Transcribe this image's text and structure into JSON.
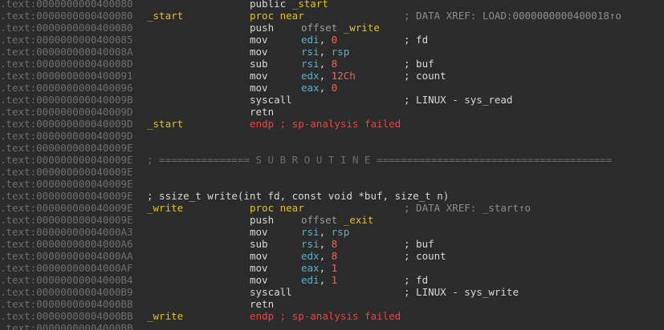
{
  "disassembly": {
    "lines": [
      {
        "addr": ".text:0000000000400080",
        "mnem": [
          {
            "t": "public ",
            "c": "c-text"
          },
          {
            "t": "_start",
            "c": "c-sym"
          }
        ]
      },
      {
        "addr": ".text:0000000000400080",
        "label": "_start",
        "mnem": [
          {
            "t": "proc near",
            "c": "c-sym"
          }
        ],
        "cmt": [
          {
            "t": "; DATA XREF: LOAD:0000000000400018↑o",
            "c": "c-xref"
          }
        ]
      },
      {
        "addr": ".text:0000000000400080",
        "mnem": [
          {
            "t": "push",
            "c": "c-text"
          }
        ],
        "ops": [
          {
            "t": "offset ",
            "c": "c-gray"
          },
          {
            "t": "_write",
            "c": "c-sym"
          }
        ]
      },
      {
        "addr": ".text:0000000000400085",
        "mnem": [
          {
            "t": "mov",
            "c": "c-text"
          }
        ],
        "ops": [
          {
            "t": "edi",
            "c": "c-reg"
          },
          {
            "t": ", ",
            "c": "c-text"
          },
          {
            "t": "0",
            "c": "c-num"
          }
        ],
        "cmt": [
          {
            "t": "; fd",
            "c": "c-text"
          }
        ]
      },
      {
        "addr": ".text:000000000040008A",
        "mnem": [
          {
            "t": "mov",
            "c": "c-text"
          }
        ],
        "ops": [
          {
            "t": "rsi",
            "c": "c-reg"
          },
          {
            "t": ", ",
            "c": "c-text"
          },
          {
            "t": "rsp",
            "c": "c-reg"
          }
        ]
      },
      {
        "addr": ".text:000000000040008D",
        "mnem": [
          {
            "t": "sub",
            "c": "c-text"
          }
        ],
        "ops": [
          {
            "t": "rsi",
            "c": "c-reg"
          },
          {
            "t": ", ",
            "c": "c-text"
          },
          {
            "t": "8",
            "c": "c-num"
          }
        ],
        "cmt": [
          {
            "t": "; buf",
            "c": "c-text"
          }
        ]
      },
      {
        "addr": ".text:0000000000400091",
        "mnem": [
          {
            "t": "mov",
            "c": "c-text"
          }
        ],
        "ops": [
          {
            "t": "edx",
            "c": "c-reg"
          },
          {
            "t": ", ",
            "c": "c-text"
          },
          {
            "t": "12Ch",
            "c": "c-num"
          }
        ],
        "cmt": [
          {
            "t": "; count",
            "c": "c-text"
          }
        ]
      },
      {
        "addr": ".text:0000000000400096",
        "mnem": [
          {
            "t": "mov",
            "c": "c-text"
          }
        ],
        "ops": [
          {
            "t": "eax",
            "c": "c-reg"
          },
          {
            "t": ", ",
            "c": "c-text"
          },
          {
            "t": "0",
            "c": "c-num"
          }
        ]
      },
      {
        "addr": ".text:000000000040009B",
        "mnem": [
          {
            "t": "syscall",
            "c": "c-text"
          }
        ],
        "cmt": [
          {
            "t": "; LINUX - sys_read",
            "c": "c-text"
          }
        ]
      },
      {
        "addr": ".text:000000000040009D",
        "mnem": [
          {
            "t": "retn",
            "c": "c-text"
          }
        ]
      },
      {
        "addr": ".text:000000000040009D",
        "label": "_start",
        "mnem": [
          {
            "t": "endp ; sp-analysis failed",
            "c": "c-red"
          }
        ]
      },
      {
        "addr": ".text:000000000040009D"
      },
      {
        "addr": ".text:000000000040009E"
      },
      {
        "addr": ".text:000000000040009E",
        "full": [
          {
            "t": "; =============== S U B R O U T I N E =======================================",
            "c": "c-dim"
          }
        ]
      },
      {
        "addr": ".text:000000000040009E"
      },
      {
        "addr": ".text:000000000040009E"
      },
      {
        "addr": ".text:000000000040009E",
        "full": [
          {
            "t": "; ssize_t write(int fd, const void *buf, size_t n)",
            "c": "c-text"
          }
        ]
      },
      {
        "addr": ".text:000000000040009E",
        "label": "_write",
        "mnem": [
          {
            "t": "proc near",
            "c": "c-sym"
          }
        ],
        "cmt": [
          {
            "t": "; DATA XREF: _start↑o",
            "c": "c-xref"
          }
        ]
      },
      {
        "addr": ".text:000000000040009E",
        "mnem": [
          {
            "t": "push",
            "c": "c-text"
          }
        ],
        "ops": [
          {
            "t": "offset ",
            "c": "c-gray"
          },
          {
            "t": "_exit",
            "c": "c-sym"
          }
        ]
      },
      {
        "addr": ".text:00000000004000A3",
        "mnem": [
          {
            "t": "mov",
            "c": "c-text"
          }
        ],
        "ops": [
          {
            "t": "rsi",
            "c": "c-reg"
          },
          {
            "t": ", ",
            "c": "c-text"
          },
          {
            "t": "rsp",
            "c": "c-reg"
          }
        ]
      },
      {
        "addr": ".text:00000000004000A6",
        "mnem": [
          {
            "t": "sub",
            "c": "c-text"
          }
        ],
        "ops": [
          {
            "t": "rsi",
            "c": "c-reg"
          },
          {
            "t": ", ",
            "c": "c-text"
          },
          {
            "t": "8",
            "c": "c-num"
          }
        ],
        "cmt": [
          {
            "t": "; buf",
            "c": "c-text"
          }
        ]
      },
      {
        "addr": ".text:00000000004000AA",
        "mnem": [
          {
            "t": "mov",
            "c": "c-text"
          }
        ],
        "ops": [
          {
            "t": "edx",
            "c": "c-reg"
          },
          {
            "t": ", ",
            "c": "c-text"
          },
          {
            "t": "8",
            "c": "c-num"
          }
        ],
        "cmt": [
          {
            "t": "; count",
            "c": "c-text"
          }
        ]
      },
      {
        "addr": ".text:00000000004000AF",
        "mnem": [
          {
            "t": "mov",
            "c": "c-text"
          }
        ],
        "ops": [
          {
            "t": "eax",
            "c": "c-reg"
          },
          {
            "t": ", ",
            "c": "c-text"
          },
          {
            "t": "1",
            "c": "c-num"
          }
        ]
      },
      {
        "addr": ".text:00000000004000B4",
        "mnem": [
          {
            "t": "mov",
            "c": "c-text"
          }
        ],
        "ops": [
          {
            "t": "edi",
            "c": "c-reg"
          },
          {
            "t": ", ",
            "c": "c-text"
          },
          {
            "t": "1",
            "c": "c-num"
          }
        ],
        "cmt": [
          {
            "t": "; fd",
            "c": "c-text"
          }
        ]
      },
      {
        "addr": ".text:00000000004000B9",
        "mnem": [
          {
            "t": "syscall",
            "c": "c-text"
          }
        ],
        "cmt": [
          {
            "t": "; LINUX - sys_write",
            "c": "c-text"
          }
        ]
      },
      {
        "addr": ".text:00000000004000BB",
        "mnem": [
          {
            "t": "retn",
            "c": "c-text"
          }
        ]
      },
      {
        "addr": ".text:00000000004000BB",
        "label": "_write",
        "mnem": [
          {
            "t": "endp ; sp-analysis failed",
            "c": "c-red"
          }
        ]
      },
      {
        "addr": ".text:00000000004000BB"
      }
    ]
  }
}
